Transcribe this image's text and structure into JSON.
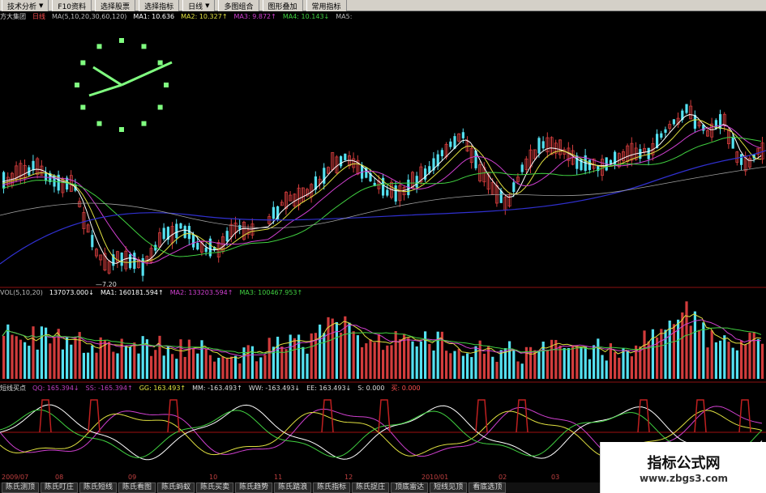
{
  "toolbar": {
    "items": [
      {
        "label": "技术分析",
        "dropdown": true
      },
      {
        "label": "F10资料",
        "dropdown": false
      },
      {
        "label": "选择股票",
        "dropdown": false
      },
      {
        "label": "选择指标",
        "dropdown": false
      },
      {
        "label": "日线",
        "dropdown": true
      },
      {
        "label": "多图组合",
        "dropdown": false
      },
      {
        "label": "图形叠加",
        "dropdown": false
      },
      {
        "label": "常用指标",
        "dropdown": false
      }
    ]
  },
  "main_info": {
    "stock_name": "方大集团",
    "period": "日线",
    "ma_formula": "MA(5,10,20,30,60,120)",
    "ma1": "MA1: 10.636",
    "ma2": "MA2: 10.327↑",
    "ma3": "MA3: 9.872↑",
    "ma4": "MA4: 10.143↓",
    "ma5": "MA5:"
  },
  "vol_info": {
    "formula": "VOL(5,10,20)",
    "vol": "137073.000↓",
    "ma1": "MA1: 160181.594↑",
    "ma2": "MA2: 133203.594↑",
    "ma3": "MA3: 100467.953↑"
  },
  "osc_info": {
    "name": "短线买点",
    "qq": "QQ: 165.394↓",
    "ss": "SS: -165.394↑",
    "gg": "GG: 163.493↑",
    "mm": "MM: -163.493↑",
    "ww": "WW: -163.493↓",
    "ee": "EE: 163.493↓",
    "s": "S: 0.000",
    "buy": "买: 0.000"
  },
  "price_labels": {
    "low_marker": "7.20"
  },
  "date_axis": [
    "2009/07",
    "08",
    "09",
    "10",
    "11",
    "12",
    "2010/01",
    "02",
    "03"
  ],
  "bottom_tabs": [
    "陈氏测顶",
    "陈氏叮庄",
    "陈氏短线",
    "陈氏看图",
    "陈氏蚂蚁",
    "陈氏买卖",
    "陈氏趋势",
    "陈氏踏浪",
    "陈氏指标",
    "陈氏捉庄",
    "顶底雷达",
    "短线见顶",
    "看底选顶"
  ],
  "watermark": {
    "title": "指标公式网",
    "url": "www.zbgs3.com"
  },
  "colors": {
    "up": "#d23c3c",
    "down": "#54e0f0",
    "ma1": "#ffffff",
    "ma2": "#e0e040",
    "ma3": "#d040d0",
    "ma4": "#40d040",
    "ma5": "#3030d0",
    "clock": "#80ff80"
  }
}
